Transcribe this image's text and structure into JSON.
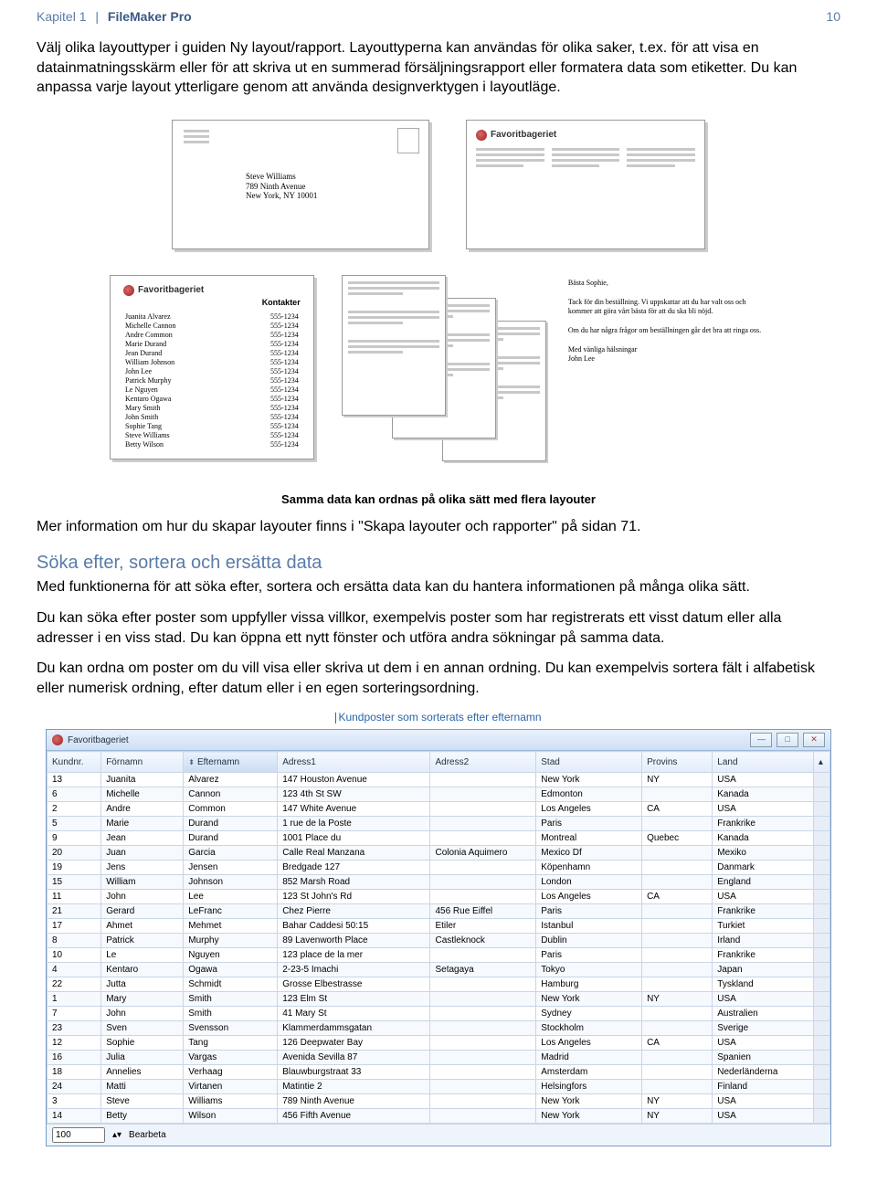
{
  "header": {
    "chapter": "Kapitel 1",
    "app": "FileMaker Pro",
    "page": "10"
  },
  "para1": "Välj olika layouttyper i guiden Ny layout/rapport. Layouttyperna kan användas för olika saker, t.ex. för att visa en datainmatningsskärm eller för att skriva ut en summerad försäljningsrapport eller formatera data som etiketter. Du kan anpassa varje layout ytterligare genom att använda designverktygen i layoutläge.",
  "envelope": {
    "name": "Steve Williams",
    "street": "789 Ninth Avenue",
    "city": "New York, NY 10001"
  },
  "brand": "Favoritbageriet",
  "contacts": {
    "title": "Kontakter",
    "rows": [
      [
        "Juanita Alvarez",
        "555-1234"
      ],
      [
        "Michelle Cannon",
        "555-1234"
      ],
      [
        "Andre Common",
        "555-1234"
      ],
      [
        "Marie Durand",
        "555-1234"
      ],
      [
        "Jean Durand",
        "555-1234"
      ],
      [
        "William Johnson",
        "555-1234"
      ],
      [
        "John Lee",
        "555-1234"
      ],
      [
        "Patrick Murphy",
        "555-1234"
      ],
      [
        "Le Nguyen",
        "555-1234"
      ],
      [
        "Kentaro Ogawa",
        "555-1234"
      ],
      [
        "Mary Smith",
        "555-1234"
      ],
      [
        "John Smith",
        "555-1234"
      ],
      [
        "Sophie Tang",
        "555-1234"
      ],
      [
        "Steve Williams",
        "555-1234"
      ],
      [
        "Betty Wilson",
        "555-1234"
      ]
    ]
  },
  "letter": {
    "greet": "Bästa Sophie,",
    "p1": "Tack för din beställning. Vi uppskattar att du har valt oss och kommer att göra vårt bästa för att du ska bli nöjd.",
    "p2": "Om du har några frågor om beställningen går det bra att ringa oss.",
    "p3": "Med vänliga hälsningar",
    "sign": "John Lee"
  },
  "caption1": "Samma data kan ordnas på olika sätt med flera layouter",
  "para2": "Mer information om hur du skapar layouter finns i \"Skapa layouter och rapporter\" på sidan 71.",
  "section": "Söka efter, sortera och ersätta data",
  "para3": "Med funktionerna för att söka efter, sortera och ersätta data kan du hantera informationen på många olika sätt.",
  "para4": "Du kan söka efter poster som uppfyller vissa villkor, exempelvis poster som har registrerats ett visst datum eller alla adresser i en viss stad. Du kan öppna ett nytt fönster och utföra andra sökningar på samma data.",
  "para5": "Du kan ordna om poster om du vill visa eller skriva ut dem i en annan ordning. Du kan exempelvis sortera fält i alfabetisk eller numerisk ordning, efter datum eller i en egen sorteringsordning.",
  "tblcaption": "Kundposter som sorterats efter efternamn",
  "win": {
    "title": "Favoritbageriet",
    "headers": [
      "Kundnr.",
      "Förnamn",
      "Efternamn",
      "Adress1",
      "Adress2",
      "Stad",
      "Provins",
      "Land"
    ],
    "rows": [
      [
        "13",
        "Juanita",
        "Alvarez",
        "147 Houston Avenue",
        "",
        "New York",
        "NY",
        "USA"
      ],
      [
        "6",
        "Michelle",
        "Cannon",
        "123 4th St SW",
        "",
        "Edmonton",
        "",
        "Kanada"
      ],
      [
        "2",
        "Andre",
        "Common",
        "147 White Avenue",
        "",
        "Los Angeles",
        "CA",
        "USA"
      ],
      [
        "5",
        "Marie",
        "Durand",
        "1 rue de la Poste",
        "",
        "Paris",
        "",
        "Frankrike"
      ],
      [
        "9",
        "Jean",
        "Durand",
        "1001 Place du",
        "",
        "Montreal",
        "Quebec",
        "Kanada"
      ],
      [
        "20",
        "Juan",
        "Garcia",
        "Calle Real Manzana",
        "Colonia Aquimero",
        "Mexico Df",
        "",
        "Mexiko"
      ],
      [
        "19",
        "Jens",
        "Jensen",
        "Bredgade 127",
        "",
        "Köpenhamn",
        "",
        "Danmark"
      ],
      [
        "15",
        "William",
        "Johnson",
        "852 Marsh Road",
        "",
        "London",
        "",
        "England"
      ],
      [
        "11",
        "John",
        "Lee",
        "123 St John's Rd",
        "",
        "Los Angeles",
        "CA",
        "USA"
      ],
      [
        "21",
        "Gerard",
        "LeFranc",
        "Chez Pierre",
        "456 Rue Eiffel",
        "Paris",
        "",
        "Frankrike"
      ],
      [
        "17",
        "Ahmet",
        "Mehmet",
        "Bahar Caddesi 50:15",
        "Etiler",
        "Istanbul",
        "",
        "Turkiet"
      ],
      [
        "8",
        "Patrick",
        "Murphy",
        "89 Lavenworth Place",
        "Castleknock",
        "Dublin",
        "",
        "Irland"
      ],
      [
        "10",
        "Le",
        "Nguyen",
        "123 place de la mer",
        "",
        "Paris",
        "",
        "Frankrike"
      ],
      [
        "4",
        "Kentaro",
        "Ogawa",
        "2-23-5 Imachi",
        "Setagaya",
        "Tokyo",
        "",
        "Japan"
      ],
      [
        "22",
        "Jutta",
        "Schmidt",
        "Grosse Elbestrasse",
        "",
        "Hamburg",
        "",
        "Tyskland"
      ],
      [
        "1",
        "Mary",
        "Smith",
        "123 Elm St",
        "",
        "New York",
        "NY",
        "USA"
      ],
      [
        "7",
        "John",
        "Smith",
        "41 Mary St",
        "",
        "Sydney",
        "",
        "Australien"
      ],
      [
        "23",
        "Sven",
        "Svensson",
        "Klammerdammsgatan",
        "",
        "Stockholm",
        "",
        "Sverige"
      ],
      [
        "12",
        "Sophie",
        "Tang",
        "126 Deepwater Bay",
        "",
        "Los Angeles",
        "CA",
        "USA"
      ],
      [
        "16",
        "Julia",
        "Vargas",
        "Avenida Sevilla 87",
        "",
        "Madrid",
        "",
        "Spanien"
      ],
      [
        "18",
        "Annelies",
        "Verhaag",
        "Blauwburgstraat 33",
        "",
        "Amsterdam",
        "",
        "Nederländerna"
      ],
      [
        "24",
        "Matti",
        "Virtanen",
        "Matintie 2",
        "",
        "Helsingfors",
        "",
        "Finland"
      ],
      [
        "3",
        "Steve",
        "Williams",
        "789 Ninth Avenue",
        "",
        "New York",
        "NY",
        "USA"
      ],
      [
        "14",
        "Betty",
        "Wilson",
        "456 Fifth Avenue",
        "",
        "New York",
        "NY",
        "USA"
      ]
    ],
    "status": {
      "zoom": "100",
      "mode": "Bearbeta"
    }
  }
}
